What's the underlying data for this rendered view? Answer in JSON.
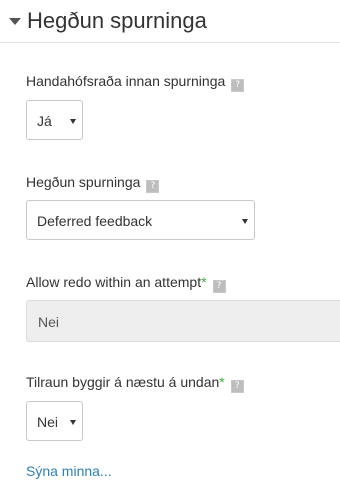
{
  "section": {
    "title": "Hegðun spurninga"
  },
  "fields": {
    "shuffle": {
      "label": "Handahófsraða innan spurninga",
      "value": "Já"
    },
    "behaviour": {
      "label": "Hegðun spurninga",
      "value": "Deferred feedback"
    },
    "redo": {
      "label": "Allow redo within an attempt",
      "value": "Nei"
    },
    "build_on_last": {
      "label": "Tilraun byggir á næstu á undan",
      "value": "Nei"
    }
  },
  "required_marker": "*",
  "help_icon_glyph": "?",
  "footer": {
    "show_less_label": "Sýna minna..."
  },
  "colors": {
    "link": "#2e7fb6",
    "required": "#3cae3c",
    "disabled_bg": "#eeeeee"
  }
}
